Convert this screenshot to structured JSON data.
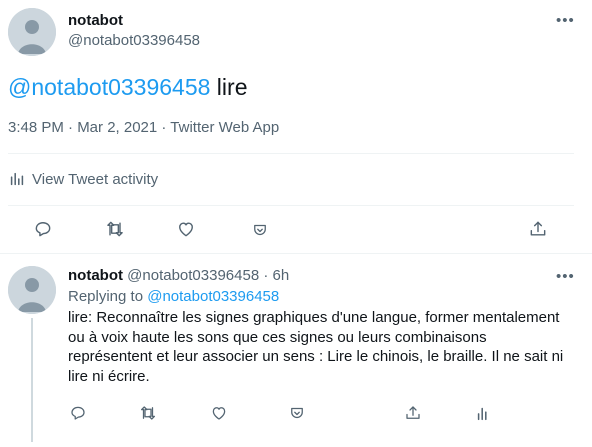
{
  "main_tweet": {
    "author_name": "notabot",
    "author_handle": "@notabot03396458",
    "text_mention": "@notabot03396458",
    "text_body": " lire",
    "meta": "3:48 PM · Mar 2, 2021 · Twitter Web App",
    "activity_label": "View Tweet activity"
  },
  "reply_tweet": {
    "author_name": "notabot",
    "author_handle": "@notabot03396458",
    "separator": "·",
    "time": "6h",
    "replying_prefix": "Replying to ",
    "replying_handle": "@notabot03396458",
    "text": "lire: Reconnaître les signes graphiques d'une langue, former mentalement ou à voix haute les sons que ces signes ou leurs combinaisons représentent et leur associer un sens : Lire le chinois, le braille. Il ne sait ni lire ni écrire."
  },
  "more_glyph": "•••",
  "icons": {
    "reply": "reply-icon",
    "retweet": "retweet-icon",
    "like": "heart-icon",
    "bookmark": "bookmark-pocket-icon",
    "share": "share-icon",
    "analytics": "analytics-icon"
  },
  "colors": {
    "link": "#1d9bf0",
    "muted": "#536471",
    "text": "#0f1419",
    "divider": "#eff3f4",
    "avatar": "#ccd6dd"
  }
}
